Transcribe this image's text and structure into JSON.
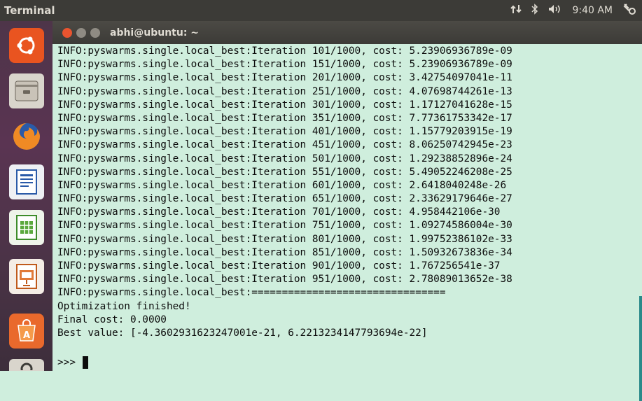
{
  "top_panel": {
    "app_title": "Terminal",
    "clock": "9:40 AM",
    "icons": [
      "network-arrows-icon",
      "bluetooth-icon",
      "volume-icon",
      "system-settings-icon"
    ]
  },
  "launcher": {
    "items": [
      "ubuntu-dash-icon",
      "files-icon",
      "firefox-icon",
      "writer-icon",
      "calc-icon",
      "impress-icon",
      "software-center-icon",
      "settings-icon"
    ]
  },
  "window": {
    "title": "abhi@ubuntu: ~"
  },
  "terminal": {
    "lines": [
      "INFO:pyswarms.single.local_best:Iteration 101/1000, cost: 5.23906936789e-09",
      "INFO:pyswarms.single.local_best:Iteration 151/1000, cost: 5.23906936789e-09",
      "INFO:pyswarms.single.local_best:Iteration 201/1000, cost: 3.42754097041e-11",
      "INFO:pyswarms.single.local_best:Iteration 251/1000, cost: 4.07698744261e-13",
      "INFO:pyswarms.single.local_best:Iteration 301/1000, cost: 1.17127041628e-15",
      "INFO:pyswarms.single.local_best:Iteration 351/1000, cost: 7.77361753342e-17",
      "INFO:pyswarms.single.local_best:Iteration 401/1000, cost: 1.15779203915e-19",
      "INFO:pyswarms.single.local_best:Iteration 451/1000, cost: 8.06250742945e-23",
      "INFO:pyswarms.single.local_best:Iteration 501/1000, cost: 1.29238852896e-24",
      "INFO:pyswarms.single.local_best:Iteration 551/1000, cost: 5.49052246208e-25",
      "INFO:pyswarms.single.local_best:Iteration 601/1000, cost: 2.6418040248e-26",
      "INFO:pyswarms.single.local_best:Iteration 651/1000, cost: 2.33629179646e-27",
      "INFO:pyswarms.single.local_best:Iteration 701/1000, cost: 4.958442106e-30",
      "INFO:pyswarms.single.local_best:Iteration 751/1000, cost: 1.09274586004e-30",
      "INFO:pyswarms.single.local_best:Iteration 801/1000, cost: 1.99752386102e-33",
      "INFO:pyswarms.single.local_best:Iteration 851/1000, cost: 1.50932673836e-34",
      "INFO:pyswarms.single.local_best:Iteration 901/1000, cost: 1.767256541e-37",
      "INFO:pyswarms.single.local_best:Iteration 951/1000, cost: 2.78089013652e-38",
      "INFO:pyswarms.single.local_best:================================",
      "Optimization finished!",
      "Final cost: 0.0000",
      "Best value: [-4.3602931623247001e-21, 6.2213234147793694e-22]"
    ],
    "prompt": ">>>"
  },
  "colors": {
    "terminal_bg": "#cfeedd",
    "panel_bg": "#3c3b37",
    "close_button": "#e9542f",
    "launcher_bg": "#5a3452"
  }
}
